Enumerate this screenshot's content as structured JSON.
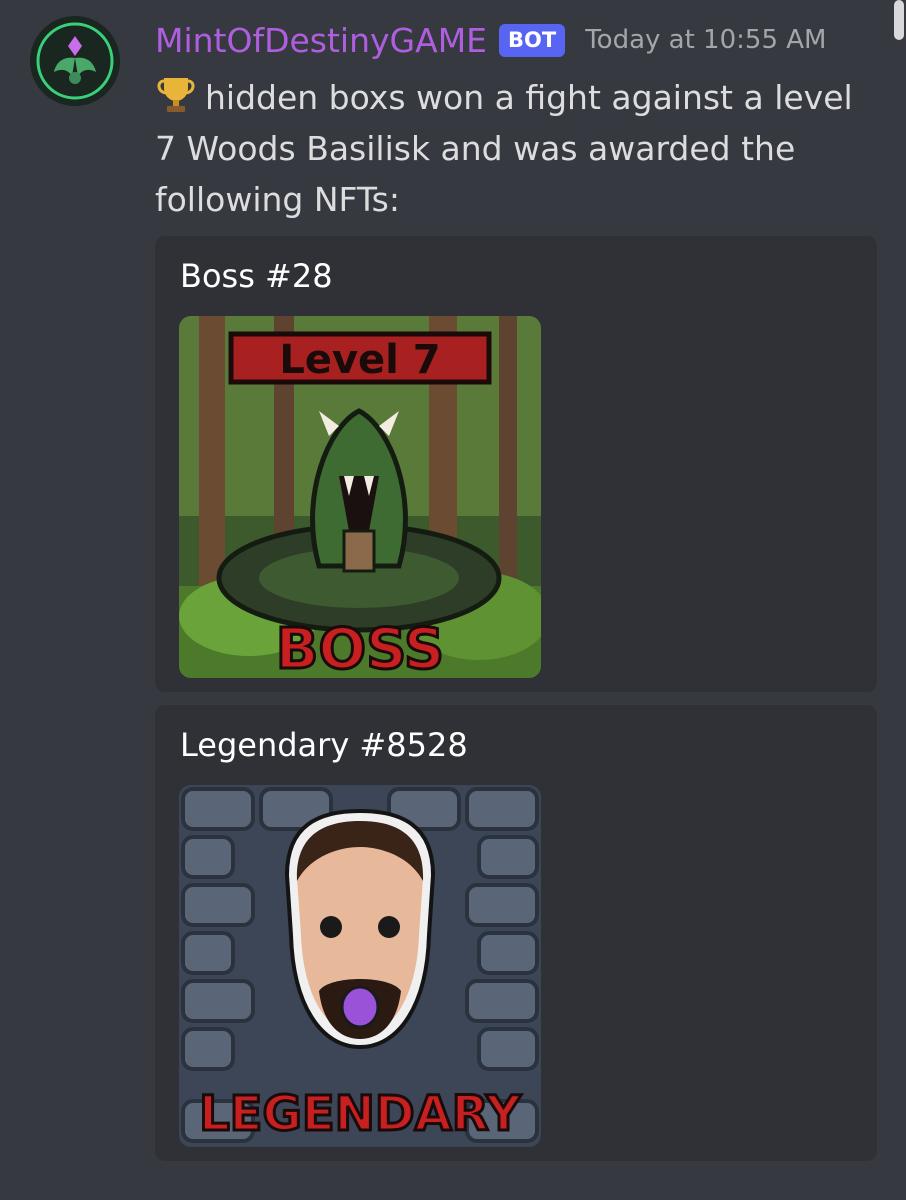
{
  "message": {
    "author": "MintOfDestinyGAME",
    "badge": "BOT",
    "timestamp": "Today at 10:55 AM",
    "emoji": "trophy-icon",
    "text": "hidden boxs won a fight against a level 7 Woods Basilisk and was awarded the following NFTs:"
  },
  "embeds": [
    {
      "title": "Boss #28",
      "image_caption_top": "Level 7",
      "image_caption_bottom": "BOSS"
    },
    {
      "title": "Legendary #8528",
      "image_caption_bottom": "LEGENDARY"
    }
  ],
  "colors": {
    "background": "#36393f",
    "embed_background": "#2f3136",
    "username": "#b05ee0",
    "bot_badge": "#5865f2",
    "timestamp": "#a3a6aa",
    "message_text": "#dcddde"
  }
}
